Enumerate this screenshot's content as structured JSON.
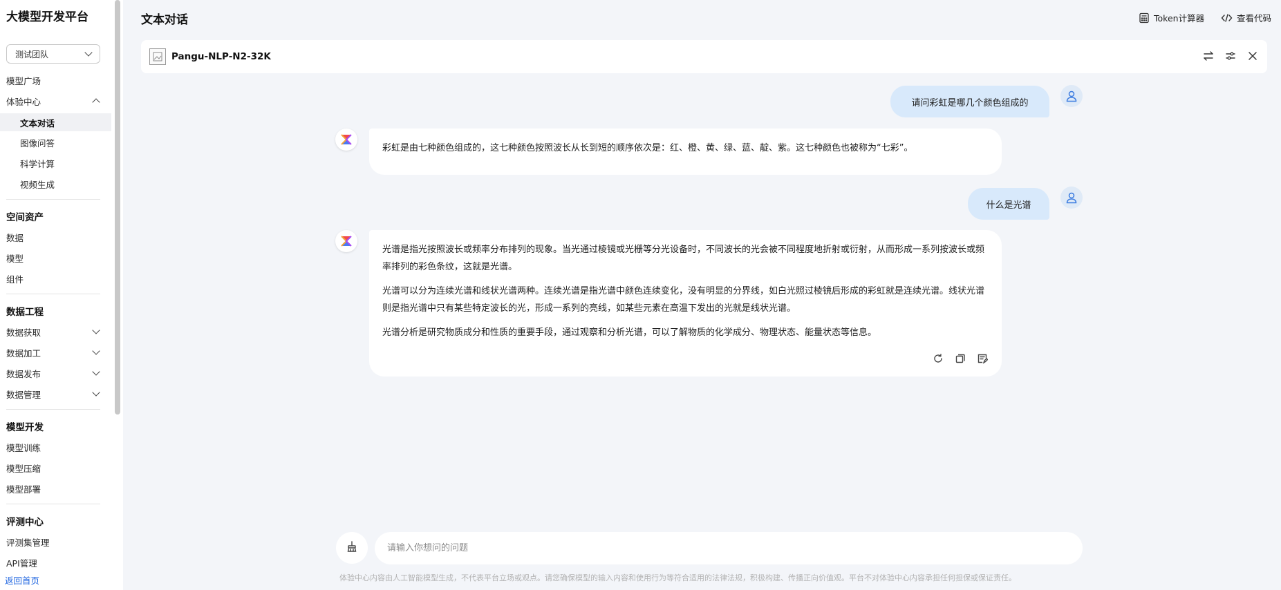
{
  "sidebar": {
    "brand": "大模型开发平台",
    "team_select": "测试团队",
    "items": {
      "model_square": "模型广场",
      "experience_center": "体验中心",
      "text_chat": "文本对话",
      "image_qa": "图像问答",
      "science_compute": "科学计算",
      "video_gen": "视频生成",
      "space_assets": "空间资产",
      "data": "数据",
      "model": "模型",
      "component": "组件",
      "data_engineering": "数据工程",
      "data_acquire": "数据获取",
      "data_process": "数据加工",
      "data_publish": "数据发布",
      "data_manage": "数据管理",
      "model_dev": "模型开发",
      "model_train": "模型训练",
      "model_compress": "模型压缩",
      "model_deploy": "模型部署",
      "eval_center": "评测中心",
      "eval_set_manage": "评测集管理",
      "api_manage": "API管理"
    },
    "back_home": "返回首页"
  },
  "header": {
    "title": "文本对话",
    "token_calc": "Token计算器",
    "view_code": "查看代码"
  },
  "model_bar": {
    "model_name": "Pangu-NLP-N2-32K"
  },
  "messages": {
    "user_1": "请问彩虹是哪几个颜色组成的",
    "bot_1": "彩虹是由七种颜色组成的，这七种颜色按照波长从长到短的顺序依次是：红、橙、黄、绿、蓝、靛、紫。这七种颜色也被称为“七彩”。",
    "user_2": "什么是光谱",
    "bot_2_p1": "光谱是指光按照波长或频率分布排列的现象。当光通过棱镜或光栅等分光设备时，不同波长的光会被不同程度地折射或衍射，从而形成一系列按波长或频率排列的彩色条纹，这就是光谱。",
    "bot_2_p2": "光谱可以分为连续光谱和线状光谱两种。连续光谱是指光谱中颜色连续变化，没有明显的分界线，如白光照过棱镜后形成的彩虹就是连续光谱。线状光谱则是指光谱中只有某些特定波长的光，形成一系列的亮线，如某些元素在高温下发出的光就是线状光谱。",
    "bot_2_p3": "光谱分析是研究物质成分和性质的重要手段，通过观察和分析光谱，可以了解物质的化学成分、物理状态、能量状态等信息。"
  },
  "input": {
    "placeholder": "请输入你想问的问题"
  },
  "disclaimer": "体验中心内容由人工智能模型生成，不代表平台立场或观点。请您确保模型的输入内容和使用行为等符合适用的法律法规，积极构建、传播正向价值观。平台不对体验中心内容承担任何担保或保证责任。",
  "colors": {
    "accent": "#2066e0",
    "user_bubble": "#d8e9fb",
    "background": "#f3f5f9"
  }
}
